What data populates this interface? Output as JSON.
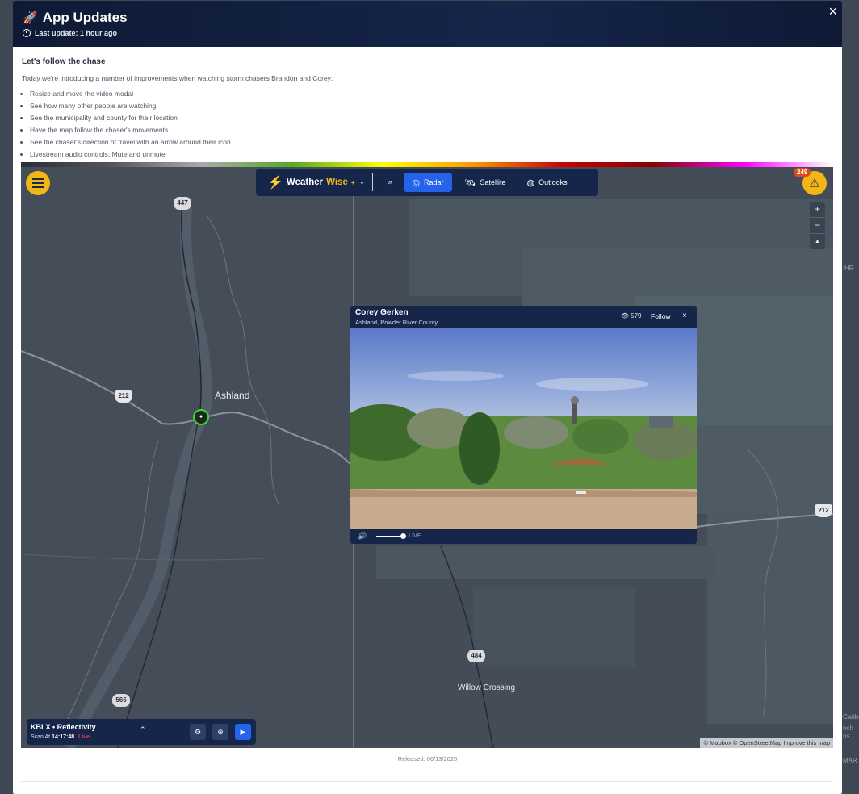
{
  "backdrop": {
    "side_label_1": "HR",
    "side_label_2": "Caribo",
    "side_label_3": "nch",
    "side_label_4": "ns",
    "side_label_5": "MAR"
  },
  "modal": {
    "title": "App Updates",
    "last_update": "Last update: 1 hour ago",
    "close_label": "×",
    "section_title": "Let's follow the chase",
    "intro": "Today we're introducing a number of improvements when watching storm chasers Brandon and Corey:",
    "features": [
      "Resize and move the video modal",
      "See how many other people are watching",
      "See the municipality and county for their location",
      "Have the map follow the chaser's movements",
      "See the chaser's direction of travel with an arrow around their icon",
      "Livestream audio controls: Mute and unmute"
    ],
    "released": "Released: 06/13/2025"
  },
  "app": {
    "brand_name": "Weather",
    "brand_accent": "Wise",
    "brand_plus": "+",
    "nav": [
      {
        "label": "Radar",
        "icon": "radar-icon",
        "active": true
      },
      {
        "label": "Satellite",
        "icon": "satellite-icon",
        "active": false
      },
      {
        "label": "Outlooks",
        "icon": "outlooks-icon",
        "active": false
      }
    ],
    "alert_count": "249",
    "zoom_in": "+",
    "zoom_out": "−",
    "compass": "▲",
    "accent_color": "#f3b617",
    "active_color": "#2563eb"
  },
  "map": {
    "places": {
      "ashland": "Ashland",
      "willow_crossing": "Willow Crossing"
    },
    "shields": {
      "r447": "447",
      "r212_left": "212",
      "r212_right": "212",
      "r484": "484",
      "r566": "566"
    },
    "attribution": "© Mapbox © OpenStreetMap Improve this map"
  },
  "video": {
    "chaser_name": "Corey Gerken",
    "location": "Ashland, Powder River County",
    "viewers": "579",
    "follow_label": "Follow",
    "close_label": "×",
    "live_label": "LIVE",
    "volume_level": 1.0
  },
  "radar_player": {
    "station": "KBLX • Reflectivity",
    "scan_label": "Scan At",
    "scan_time": "14:17:48",
    "live_label": "Live"
  }
}
